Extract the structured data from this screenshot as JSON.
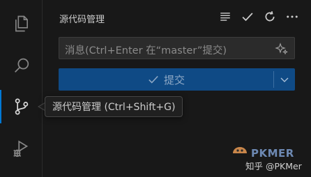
{
  "panel": {
    "title": "源代码管理",
    "actions": [
      "list-icon",
      "check-icon",
      "refresh-icon",
      "more-icon"
    ]
  },
  "commit_message": {
    "placeholder": "消息(Ctrl+Enter 在“master”提交)"
  },
  "commit_button": {
    "label": "提交"
  },
  "tooltip": {
    "text": "源代码管理 (Ctrl+Shift+G)"
  },
  "watermark": {
    "brand": "PKMER",
    "text": "知乎 @PKMer"
  },
  "activity_bar": {
    "items": [
      "explorer-icon",
      "search-icon",
      "source-control-icon",
      "run-debug-icon"
    ],
    "active": "source-control-icon",
    "accent": "#0078d4"
  }
}
